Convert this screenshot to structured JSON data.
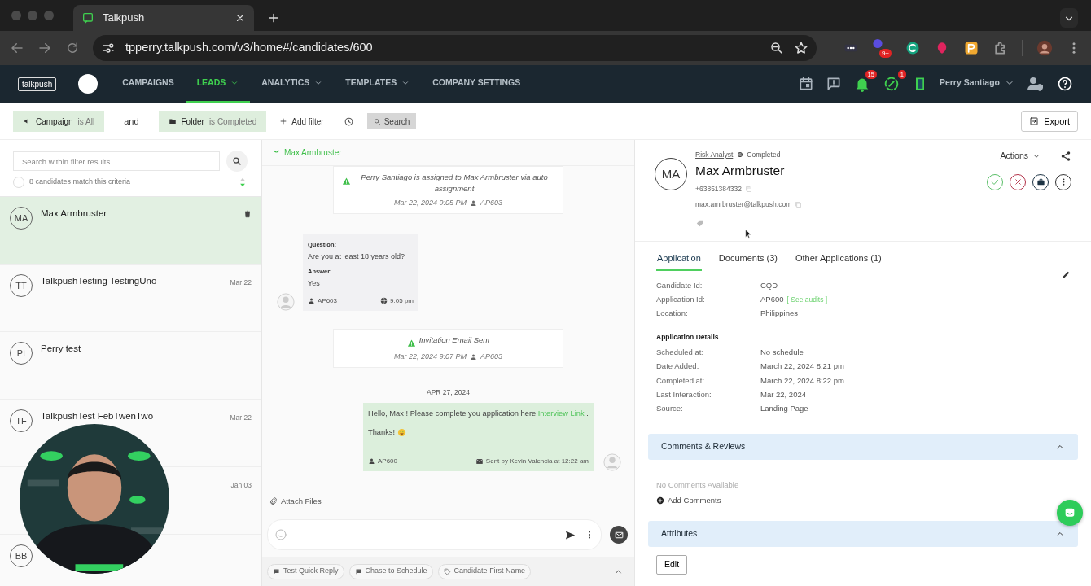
{
  "browser": {
    "tab_title": "Talkpush",
    "url": "tpperry.talkpush.com/v3/home#/candidates/600",
    "extension_badge": "9+"
  },
  "navbar": {
    "logo": "talkpush",
    "menu": [
      {
        "label": "CAMPAIGNS",
        "selected": false,
        "dropdown": false
      },
      {
        "label": "LEADS",
        "selected": true,
        "dropdown": true
      },
      {
        "label": "ANALYTICS",
        "selected": false,
        "dropdown": true
      },
      {
        "label": "TEMPLATES",
        "selected": false,
        "dropdown": true
      },
      {
        "label": "COMPANY SETTINGS",
        "selected": false,
        "dropdown": false
      }
    ],
    "notification_count": "15",
    "alert_count": "1",
    "user": "Perry Santiago"
  },
  "filter_bar": {
    "filters": [
      {
        "kind": "campaign",
        "field": "Campaign",
        "value": "is All"
      },
      {
        "kind": "folder",
        "field": "Folder",
        "value": "is Completed"
      }
    ],
    "joiner": "and",
    "add_filter": "Add filter",
    "search_button": "Search",
    "export_button": "Export"
  },
  "candidates": {
    "search_placeholder": "Search within filter results",
    "match_count": "8 candidates match this criteria",
    "select_all_checked": false,
    "items": [
      {
        "initials": "MA",
        "name": "Max Armbruster",
        "selected": true
      },
      {
        "initials": "TT",
        "name": "TalkpushTesting TestingUno",
        "date": "Mar 22",
        "selected": false
      },
      {
        "initials": "Pt",
        "name": "Perry test",
        "selected": false
      },
      {
        "initials": "TF",
        "name": "TalkpushTest FebTwenTwo",
        "date": "Mar 22",
        "selected": false
      },
      {
        "date": "Jan 03",
        "selected": false
      },
      {
        "initials": "BB",
        "selected": false
      }
    ]
  },
  "chat": {
    "header_name": "Max Armbruster",
    "events": [
      {
        "kind": "system",
        "text": "Perry Santiago is assigned to Max Armbruster via auto assignment",
        "time": "Mar 22, 2024 9:05 PM",
        "agent": "AP603"
      },
      {
        "kind": "qa",
        "question_label": "Question:",
        "question": "Are you at least 18 years old?",
        "answer_label": "Answer:",
        "answer": "Yes",
        "agent": "AP603",
        "time": "9:05 pm"
      },
      {
        "kind": "system",
        "text": "Invitation Email Sent",
        "time": "Mar 22, 2024 9:07 PM",
        "agent": "AP603"
      },
      {
        "kind": "date",
        "text": "APR 27, 2024"
      },
      {
        "kind": "outgoing",
        "text": "Hello, Max ! Please complete you application here ",
        "link": "Interview Link",
        "after_link": " .",
        "closing": "Thanks!",
        "agent": "AP600",
        "sent_by": "Sent by Kevin Valencia at 12:22 am"
      }
    ],
    "attach": "Attach Files",
    "quick_replies": [
      {
        "kind": "message",
        "label": "Test Quick Reply"
      },
      {
        "kind": "message",
        "label": "Chase to Schedule"
      },
      {
        "kind": "tag",
        "label": "Candidate First Name"
      }
    ]
  },
  "profile": {
    "job": "Risk Analyst",
    "status": "Completed",
    "initials": "MA",
    "name": "Max Armbruster",
    "phone": "+63851384332",
    "email": "max.amrbruster@talkpush.com",
    "actions": "Actions",
    "tabs": [
      {
        "label": "Application",
        "selected": true
      },
      {
        "label": "Documents (3)",
        "selected": false
      },
      {
        "label": "Other Applications (1)",
        "selected": false
      }
    ],
    "fields": [
      {
        "label": "Candidate Id:",
        "value": "CQD"
      },
      {
        "label": "Application Id:",
        "value": "AP600",
        "link": "[ See audits ]"
      },
      {
        "label": "Location:",
        "value": "Philippines"
      }
    ],
    "details_title": "Application Details",
    "details": [
      {
        "label": "Scheduled at:",
        "value": "No schedule"
      },
      {
        "label": "Date Added:",
        "value": "March 22, 2024 8:21 pm"
      },
      {
        "label": "Completed at:",
        "value": "March 22, 2024 8:22 pm"
      },
      {
        "label": "Last Interaction:",
        "value": "Mar 22, 2024"
      },
      {
        "label": "Source:",
        "value": "Landing Page"
      }
    ],
    "sections": [
      {
        "title": "Comments & Reviews",
        "expanded": true,
        "kind": "comments",
        "empty": "No Comments Available",
        "add": "Add Comments"
      },
      {
        "title": "Attributes",
        "expanded": true,
        "kind": "attributes",
        "button": "Edit"
      }
    ]
  }
}
